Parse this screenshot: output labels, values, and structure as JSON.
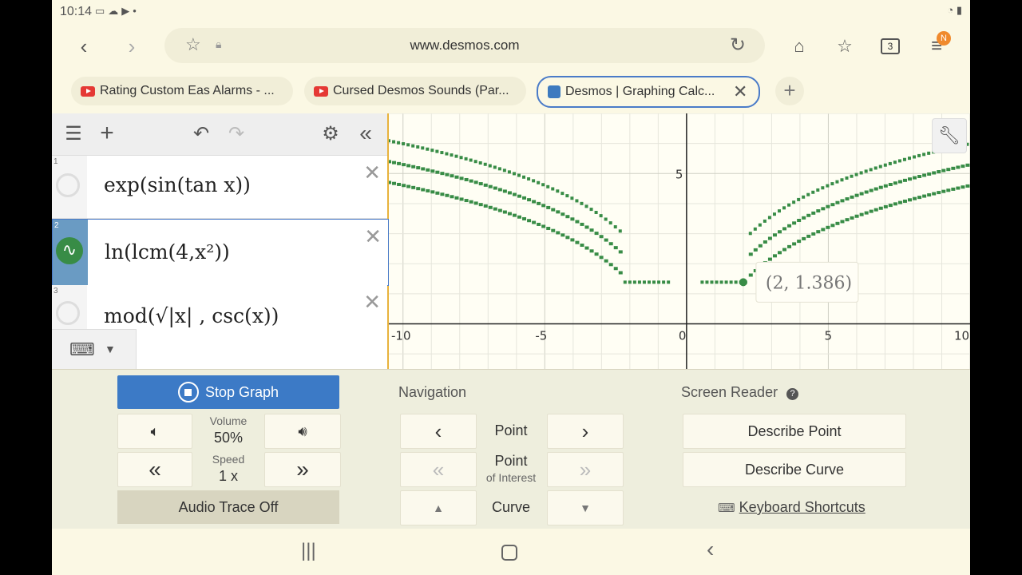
{
  "status": {
    "time": "10:14"
  },
  "browser": {
    "url": "www.desmos.com",
    "tab_count": "3",
    "profile_initial": "N",
    "tabs": [
      {
        "label": "Rating Custom Eas Alarms - ..."
      },
      {
        "label": "Cursed Desmos Sounds (Par..."
      },
      {
        "label": "Desmos | Graphing Calc..."
      }
    ]
  },
  "expressions": [
    {
      "num": "1",
      "latex": "exp(sin(tan x))"
    },
    {
      "num": "2",
      "latex": "ln(lcm(4,x²))"
    },
    {
      "num": "3",
      "latex": "mod(√|x| , csc(x))"
    }
  ],
  "graph": {
    "x_ticks": [
      "-10",
      "-5",
      "0",
      "5",
      "10"
    ],
    "y_ticks": [
      "5"
    ],
    "tooltip": "(2, 1.386)"
  },
  "chart_data": {
    "type": "scatter",
    "xlim": [
      -10.5,
      10
    ],
    "ylim": [
      -1.5,
      7
    ],
    "grid": true,
    "colors": {
      "series": "#388c46"
    }
  },
  "audio": {
    "stop_label": "Stop Graph",
    "volume_label": "Volume",
    "volume_value": "50%",
    "speed_label": "Speed",
    "speed_value": "1 x",
    "trace_label": "Audio Trace Off",
    "navigation_heading": "Navigation",
    "nav_point": "Point",
    "nav_poi_line1": "Point",
    "nav_poi_line2": "of Interest",
    "nav_curve": "Curve",
    "screen_reader_heading": "Screen Reader",
    "describe_point": "Describe Point",
    "describe_curve": "Describe Curve",
    "keyboard_shortcuts": "Keyboard Shortcuts"
  }
}
